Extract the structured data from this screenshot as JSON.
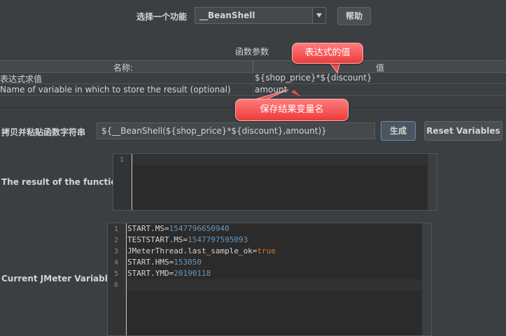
{
  "selector": {
    "label": "选择一个功能",
    "value": "__BeanShell",
    "help_button": "帮助"
  },
  "params": {
    "title": "函数参数",
    "col_name": "名称:",
    "col_value": "值",
    "rows": [
      {
        "name": "表达式求值",
        "value": "${shop_price}*${discount}"
      },
      {
        "name": "Name of variable in which to store the result (optional)",
        "value": "amount"
      }
    ]
  },
  "callouts": {
    "value": "表达式的值",
    "result": "保存结果变量名"
  },
  "copy": {
    "label": "拷贝并粘贴函数字符串",
    "value": "${__BeanShell(${shop_price}*${discount},amount)}",
    "generate_button": "生成",
    "reset_button": "Reset Variables"
  },
  "result": {
    "label": "The result of the function is",
    "line_numbers": [
      "1"
    ]
  },
  "variables": {
    "label": "Current JMeter Variables",
    "line_numbers": [
      "1",
      "2",
      "3",
      "4",
      "5",
      "6"
    ],
    "lines": [
      {
        "key": "START.MS=",
        "val": "1547796650940"
      },
      {
        "key": "TESTSTART.MS=",
        "val": "1547797595093"
      },
      {
        "key": "JMeterThread.last_sample_ok=",
        "val": "true"
      },
      {
        "key": "START.HMS=",
        "val": "153050"
      },
      {
        "key": "START.YMD=",
        "val": "20190118"
      }
    ]
  },
  "colors": {
    "background": "#3c3f41",
    "editor_bg": "#2b2b2b",
    "number": "#6897bb",
    "keyword": "#cc7832",
    "callout": "#ee3b3b"
  }
}
